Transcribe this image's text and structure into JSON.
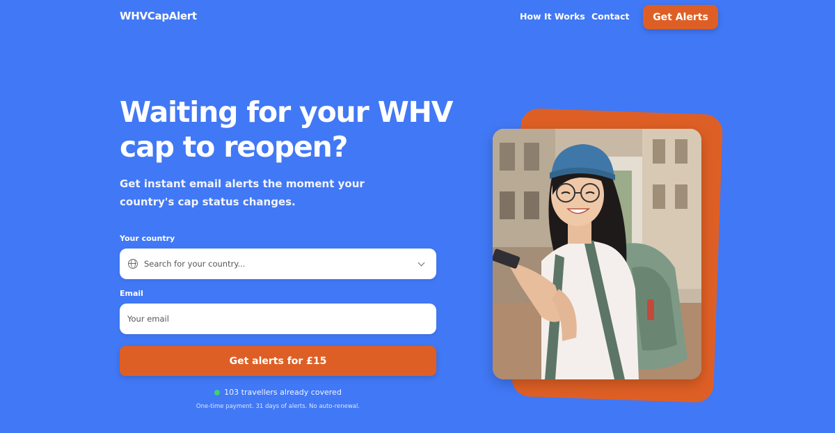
{
  "header": {
    "logo": "WHVCapAlert",
    "nav": [
      {
        "label": "How It Works"
      },
      {
        "label": "Contact"
      }
    ],
    "cta_label": "Get Alerts"
  },
  "hero": {
    "title": "Waiting for your WHV cap to reopen?",
    "subtitle": "Get instant email alerts the moment your country's cap status changes."
  },
  "form": {
    "country_label": "Your country",
    "country_placeholder": "Search for your country...",
    "country_icon": "globe-icon",
    "dropdown_icon": "chevron-down-icon",
    "email_label": "Email",
    "email_placeholder": "Your email",
    "submit_label": "Get alerts for £15"
  },
  "footer_note": {
    "social_proof": "103 travellers already covered",
    "fine_print": "One-time payment. 31 days of alerts. No auto-renewal."
  },
  "colors": {
    "background": "#4178f5",
    "accent": "#de5f25",
    "status_dot": "#3ed46b"
  },
  "image": {
    "icon": "traveller-photo"
  }
}
